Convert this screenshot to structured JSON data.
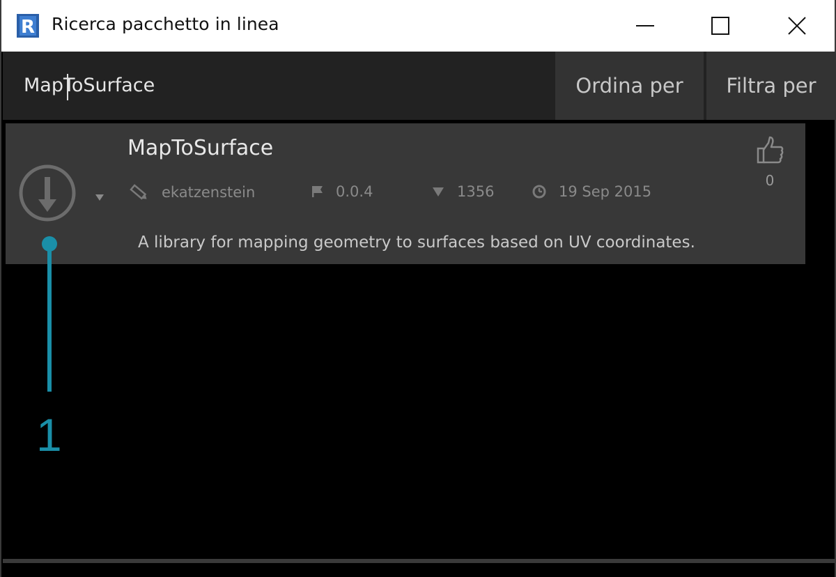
{
  "window": {
    "title": "Ricerca pacchetto in linea",
    "app_icon": "revit-logo",
    "controls": [
      "minimize-icon",
      "maximize-icon",
      "close-icon"
    ]
  },
  "search": {
    "value": "MapToSurface",
    "sort_label": "Ordina per",
    "filter_label": "Filtra per"
  },
  "package": {
    "name": "MapToSurface",
    "author": "ekatzenstein",
    "version": "0.0.4",
    "downloads": "1356",
    "date": "19 Sep 2015",
    "description": "A library for mapping geometry to surfaces based on UV coordinates.",
    "likes": "0"
  },
  "annotation": {
    "number": "1",
    "color": "#1a8fa8"
  },
  "colors": {
    "background": "#000000",
    "searchbar": "#222222",
    "card": "#383838",
    "accent": "#1a8fa8"
  }
}
